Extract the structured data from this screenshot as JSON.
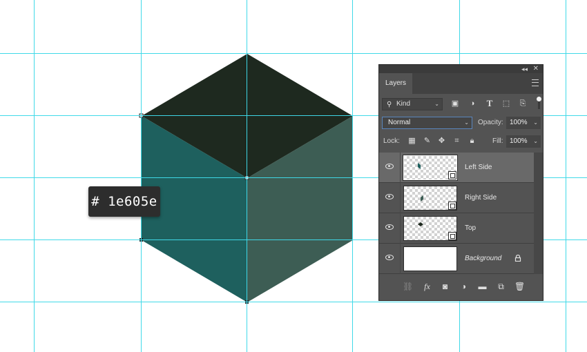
{
  "canvas": {
    "tooltip": "# 1e605e",
    "cube": {
      "top_color": "#1e291f",
      "left_color": "#1e605e",
      "right_color": "#3d5d54"
    },
    "guide_color": "#3fd9e8"
  },
  "layers_panel": {
    "tab_label": "Layers",
    "filter": {
      "kind_label": "Kind"
    },
    "blend_mode": "Normal",
    "opacity_label": "Opacity:",
    "opacity_value": "100%",
    "lock_label": "Lock:",
    "fill_label": "Fill:",
    "fill_value": "100%",
    "layers": [
      {
        "name": "Left Side",
        "selected": true,
        "thumb_color": "#1e605e"
      },
      {
        "name": "Right Side",
        "selected": false,
        "thumb_color": "#3d5d54"
      },
      {
        "name": "Top",
        "selected": false,
        "thumb_color": "#1e291f"
      },
      {
        "name": "Background",
        "selected": false,
        "locked": true
      }
    ],
    "icons": {
      "filter": [
        "image-filter-icon",
        "adjustment-filter-icon",
        "type-filter-icon",
        "shape-filter-icon",
        "smart-object-filter-icon"
      ],
      "lock": [
        "lock-transparent-pixels-icon",
        "lock-image-pixels-icon",
        "lock-position-icon",
        "lock-artboard-icon",
        "lock-all-icon"
      ],
      "bottom": [
        "link-layers-icon",
        "layer-style-icon",
        "layer-mask-icon",
        "adjustment-layer-icon",
        "new-group-icon",
        "new-layer-icon",
        "delete-layer-icon"
      ]
    }
  }
}
